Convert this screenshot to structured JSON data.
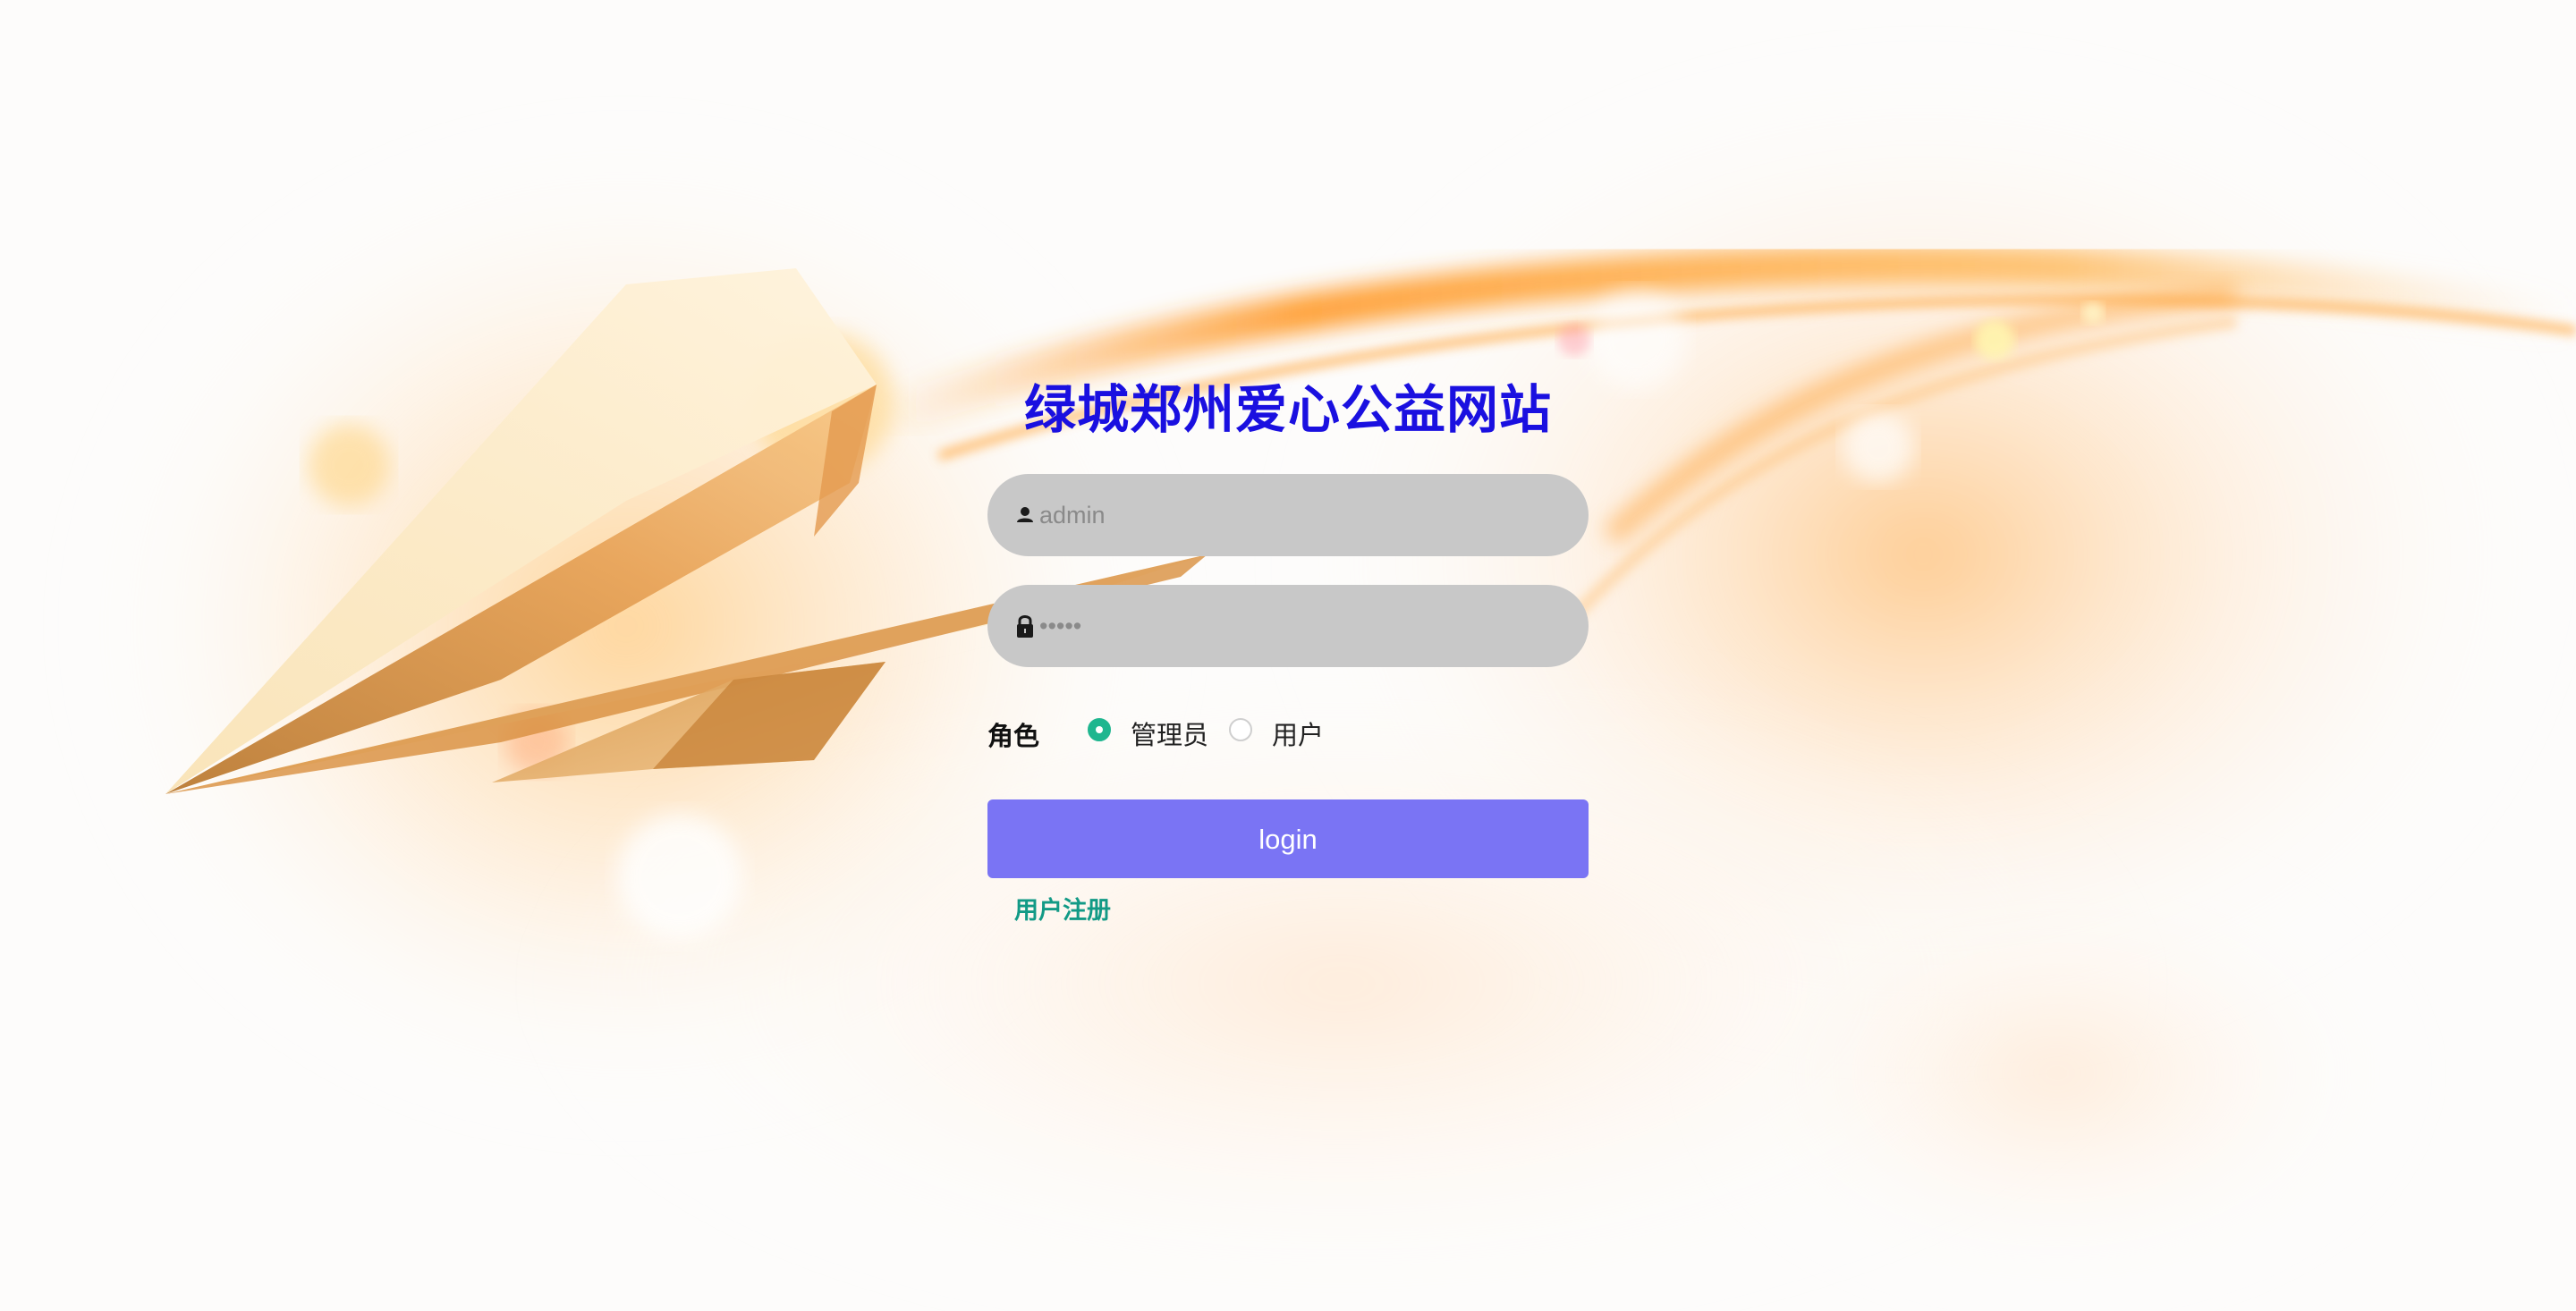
{
  "page": {
    "title": "绿城郑州爱心公益网站"
  },
  "form": {
    "username": {
      "placeholder": "admin",
      "value": "",
      "icon": "user-icon"
    },
    "password": {
      "value": "admin",
      "icon": "lock-icon"
    },
    "role": {
      "label": "角色",
      "options": [
        {
          "label": "管理员",
          "selected": true
        },
        {
          "label": "用户",
          "selected": false
        }
      ]
    },
    "login_label": "login",
    "register_label": "用户注册"
  },
  "colors": {
    "title": "#1a10e0",
    "field_bg": "#c8c8c8",
    "login_button": "#7a74f4",
    "radio_checked": "#1fb68f",
    "register_link": "#129a86"
  }
}
